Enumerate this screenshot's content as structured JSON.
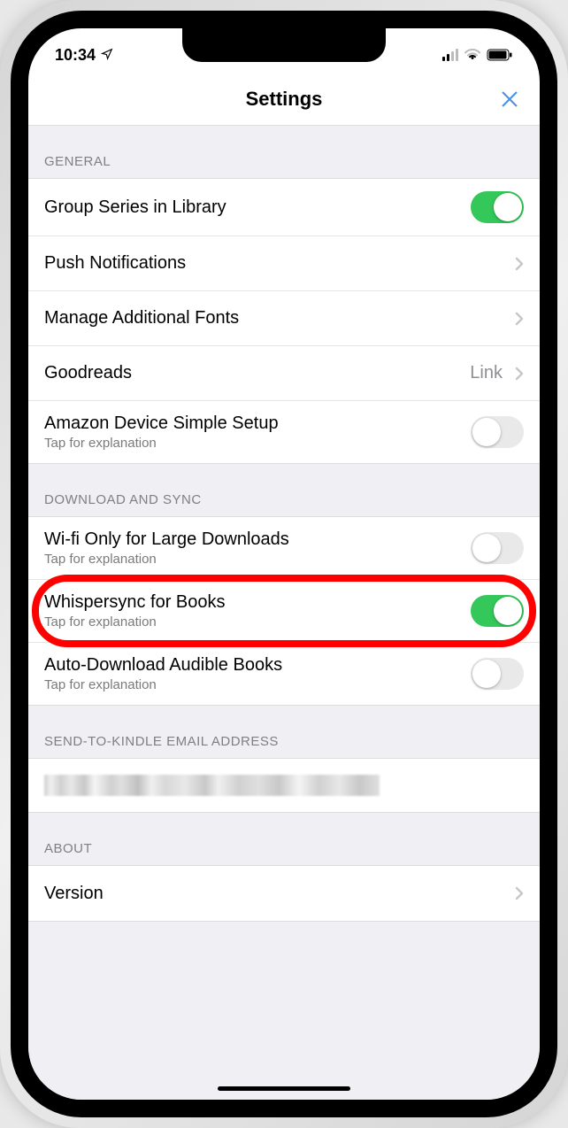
{
  "status": {
    "time": "10:34",
    "location_icon": "location-arrow-icon"
  },
  "header": {
    "title": "Settings",
    "close": "close-icon"
  },
  "sections": {
    "general": {
      "header": "GENERAL",
      "rows": {
        "group_series": {
          "title": "Group Series in Library",
          "toggle_on": true
        },
        "push": {
          "title": "Push Notifications"
        },
        "fonts": {
          "title": "Manage Additional Fonts"
        },
        "goodreads": {
          "title": "Goodreads",
          "value": "Link"
        },
        "simple_setup": {
          "title": "Amazon Device Simple Setup",
          "sub": "Tap for explanation",
          "toggle_on": false
        }
      }
    },
    "download_sync": {
      "header": "DOWNLOAD AND SYNC",
      "rows": {
        "wifi_only": {
          "title": "Wi-fi Only for Large Downloads",
          "sub": "Tap for explanation",
          "toggle_on": false
        },
        "whispersync": {
          "title": "Whispersync for Books",
          "sub": "Tap for explanation",
          "toggle_on": true
        },
        "auto_audible": {
          "title": "Auto-Download Audible Books",
          "sub": "Tap for explanation",
          "toggle_on": false
        }
      }
    },
    "send_to_kindle": {
      "header": "SEND-TO-KINDLE EMAIL ADDRESS"
    },
    "about": {
      "header": "ABOUT",
      "rows": {
        "version": {
          "title": "Version"
        }
      }
    }
  },
  "highlight_row": "whispersync"
}
